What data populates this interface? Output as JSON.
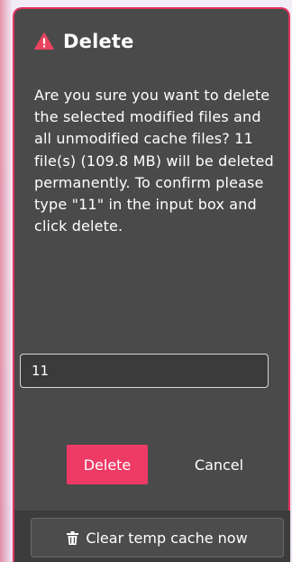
{
  "dialog": {
    "title": "Delete",
    "title_icon": "warning-triangle-icon",
    "message": "Are you sure you want to delete the selected modified files and all unmodified cache files? 11 file(s) (109.8 MB) will be deleted permanently. To confirm please type \"11\" in the input box and click delete.",
    "input_value": "11",
    "delete_label": "Delete",
    "cancel_label": "Cancel"
  },
  "footer": {
    "clear_cache_label": "Clear temp cache now",
    "clear_cache_icon": "trash-icon"
  },
  "colors": {
    "accent": "#ee3b66",
    "dialog_bg": "#4a4a4a",
    "border": "#e0335f",
    "warning": "#e8435f"
  }
}
